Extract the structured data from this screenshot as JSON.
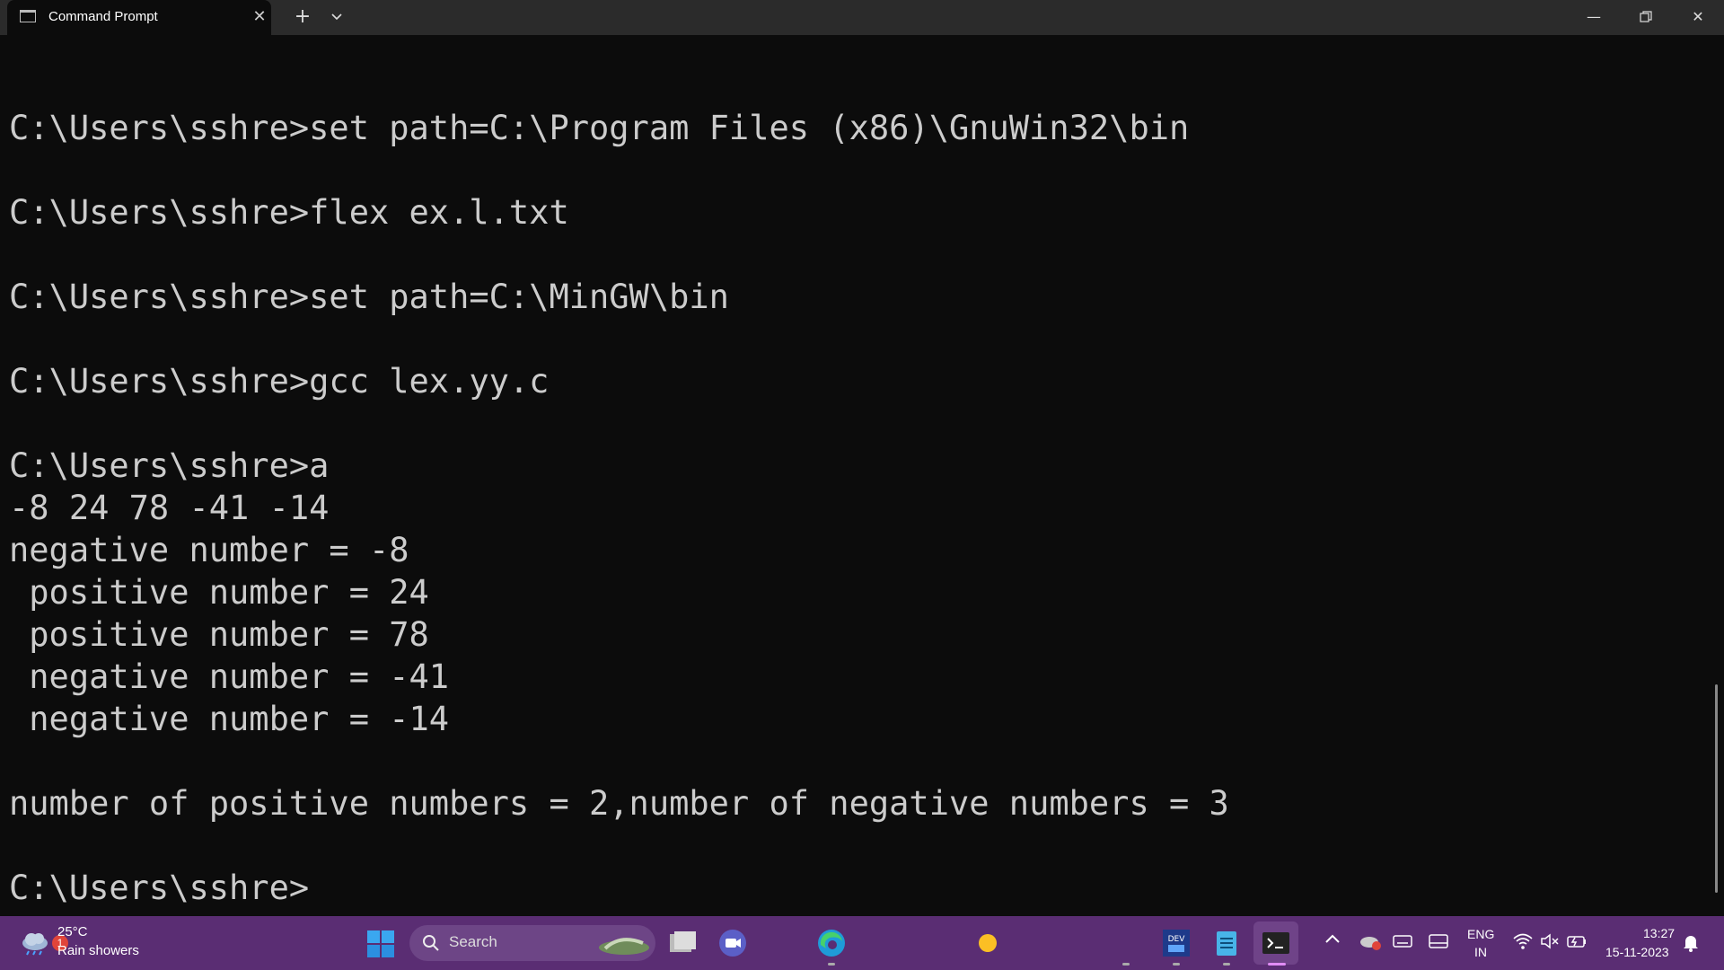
{
  "window": {
    "tab_title": "Command Prompt",
    "tab_close": "✕",
    "new_tab": "+",
    "tab_dropdown": "⌄",
    "minimize": "—",
    "maximize": "❐",
    "close": "✕"
  },
  "terminal": {
    "lines": [
      "C:\\Users\\sshre>set path=C:\\Program Files (x86)\\GnuWin32\\bin",
      "C:\\Users\\sshre>flex ex.l.txt",
      "C:\\Users\\sshre>set path=C:\\MinGW\\bin",
      "C:\\Users\\sshre>gcc lex.yy.c",
      "C:\\Users\\sshre>a",
      "-8 24 78 -41 -14",
      "negative number = -8",
      " positive number = 24",
      " positive number = 78",
      " negative number = -41",
      " negative number = -14",
      "number of positive numbers = 2,number of negative numbers = 3",
      "C:\\Users\\sshre>"
    ]
  },
  "taskbar": {
    "weather_badge": "1",
    "weather_temp": "25°C",
    "weather_desc": "Rain showers",
    "search_label": "Search",
    "lang_line1": "ENG",
    "lang_line2": "IN",
    "time": "13:27",
    "date": "15-11-2023",
    "icons": [
      "windows-start-icon",
      "search-icon",
      "file-explorer-icon",
      "video-meet-icon",
      "edge-browser-icon",
      "sun-icon",
      "dev-home-icon",
      "notepad-icon",
      "terminal-icon",
      "chevron-up-icon",
      "onedrive-icon",
      "keyboard-icon",
      "display-icon",
      "wifi-icon",
      "volume-muted-icon",
      "battery-icon",
      "notification-bell-icon"
    ]
  },
  "colors": {
    "terminal_bg": "#0c0c0c",
    "terminal_text": "#cccccc",
    "titlebar_bg": "#2b2b2b",
    "taskbar_bg": "#5a2d73"
  }
}
